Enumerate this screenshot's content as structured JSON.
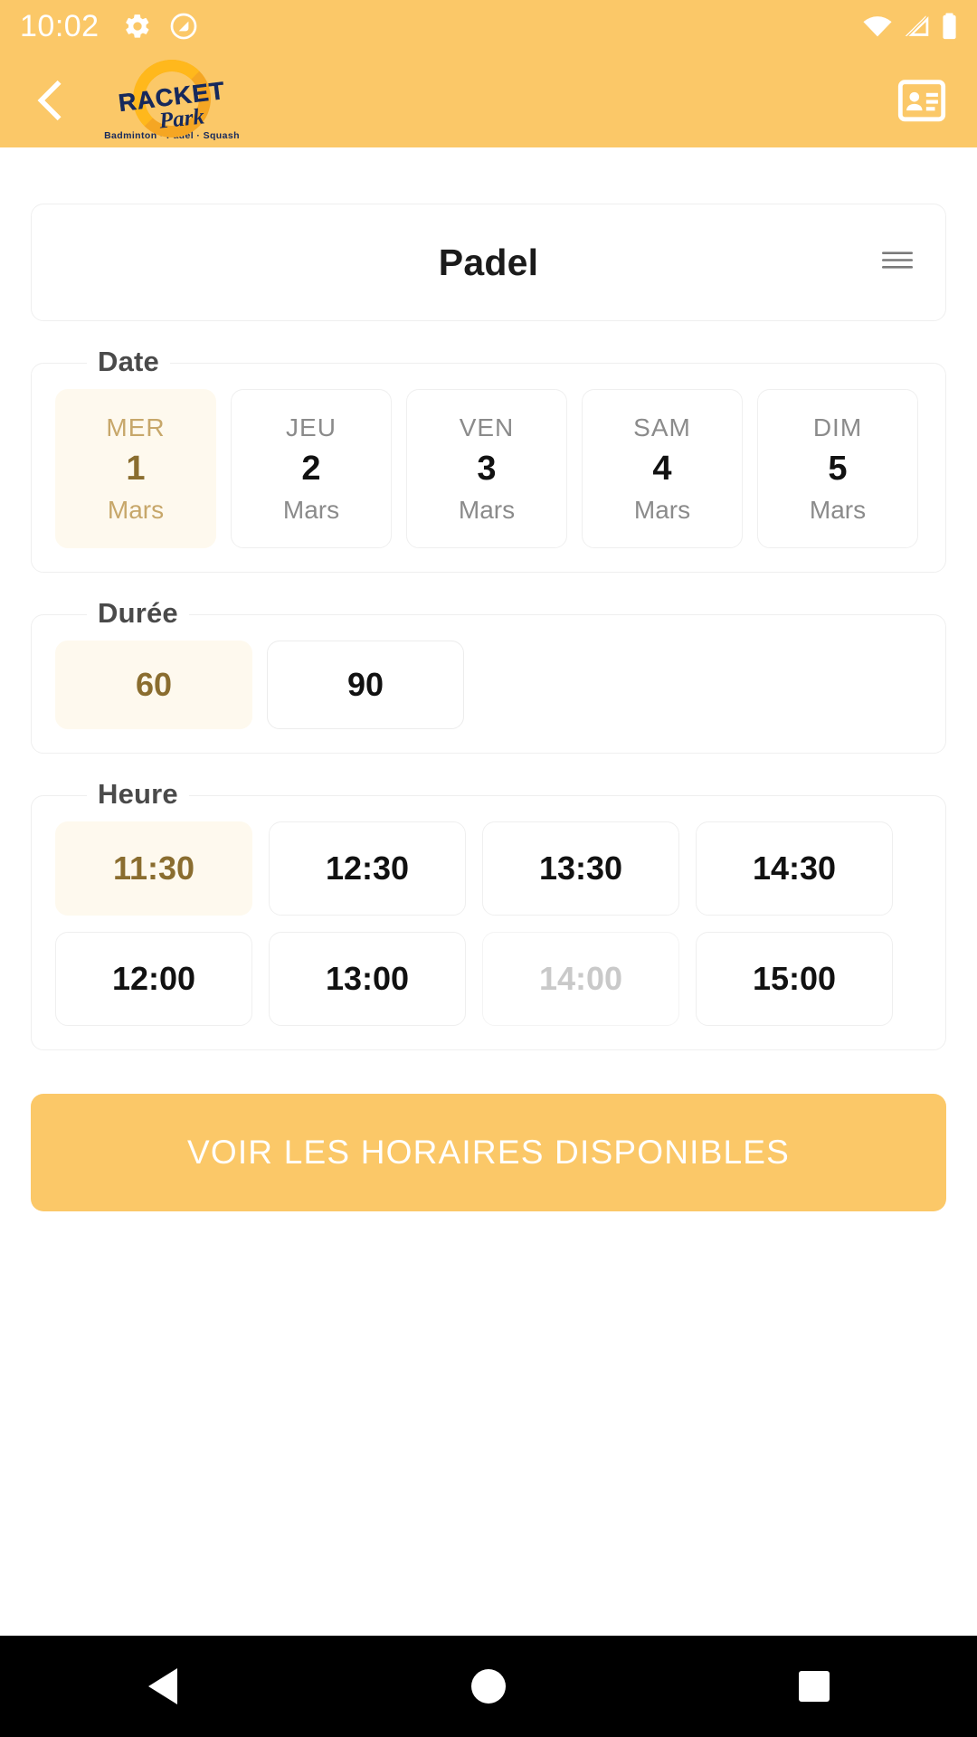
{
  "status_bar": {
    "time": "10:02",
    "icons": [
      "gear-icon",
      "do-not-disturb-icon",
      "wifi-icon",
      "cellular-signal-icon",
      "battery-icon"
    ]
  },
  "app_bar": {
    "back_icon": "chevron-left-icon",
    "profile_icon": "contact-card-icon",
    "logo": {
      "line1": "RACKET",
      "line2": "Park",
      "subtitle": "Badminton  ·  Padel  ·  Squash"
    },
    "background_color": "#FBC868"
  },
  "sport_card": {
    "title": "Padel",
    "menu_icon": "list-menu-icon"
  },
  "date_section": {
    "label": "Date",
    "items": [
      {
        "dow": "MER",
        "day": "1",
        "month": "Mars",
        "selected": true
      },
      {
        "dow": "JEU",
        "day": "2",
        "month": "Mars",
        "selected": false
      },
      {
        "dow": "VEN",
        "day": "3",
        "month": "Mars",
        "selected": false
      },
      {
        "dow": "SAM",
        "day": "4",
        "month": "Mars",
        "selected": false
      },
      {
        "dow": "DIM",
        "day": "5",
        "month": "Mars",
        "selected": false
      }
    ]
  },
  "duration_section": {
    "label": "Durée",
    "items": [
      {
        "value": "60",
        "selected": true
      },
      {
        "value": "90",
        "selected": false
      }
    ]
  },
  "time_section": {
    "label": "Heure",
    "row1": [
      {
        "value": "11:30",
        "selected": true,
        "disabled": false
      },
      {
        "value": "12:30",
        "selected": false,
        "disabled": false
      },
      {
        "value": "13:30",
        "selected": false,
        "disabled": false
      },
      {
        "value": "14:30",
        "selected": false,
        "disabled": false
      }
    ],
    "row2": [
      {
        "value": "12:00",
        "selected": false,
        "disabled": false
      },
      {
        "value": "13:00",
        "selected": false,
        "disabled": false
      },
      {
        "value": "14:00",
        "selected": false,
        "disabled": true
      },
      {
        "value": "15:00",
        "selected": false,
        "disabled": false
      }
    ]
  },
  "cta": {
    "label": "VOIR LES HORAIRES DISPONIBLES",
    "color": "#FBC868"
  },
  "nav_bar": {
    "back": "back-triangle-icon",
    "home": "home-circle-icon",
    "recents": "recents-square-icon"
  },
  "theme": {
    "accent": "#FBC868",
    "selected_bg": "#FEF9EE",
    "selected_text": "#8A6D2F",
    "muted_text": "#8b8b8b"
  }
}
